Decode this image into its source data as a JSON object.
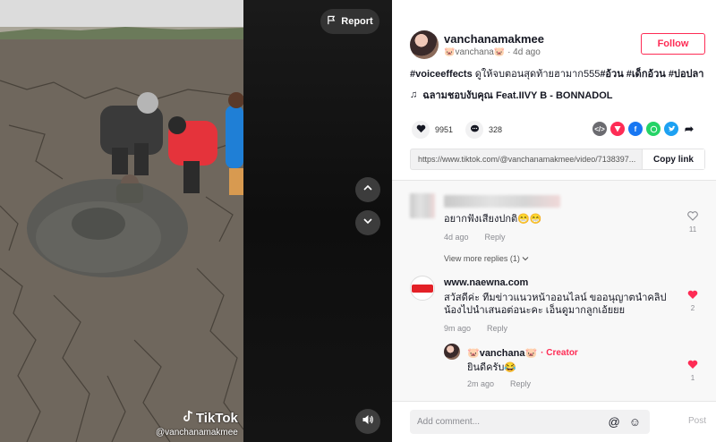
{
  "video": {
    "report_label": "Report",
    "watermark_brand": "TikTok",
    "watermark_user": "@vanchanamakmee"
  },
  "author": {
    "username": "vanchanamakmee",
    "nickname": "🐷vanchana🐷",
    "date": "4d ago",
    "follow_label": "Follow"
  },
  "caption": {
    "tag1": "#voiceeffects",
    "text": "ดูให้จบตอนสุดท้ายฮามาก555",
    "tag2": "#อ้วน",
    "tag3": "#เด็กอ้วน",
    "tag4": "#บ่อปลา"
  },
  "music": "ฉลามชอบงับคุณ Feat.IIVY B - BONNADOL",
  "stats": {
    "likes": "9951",
    "comments": "328"
  },
  "share": {
    "link": "https://www.tiktok.com/@vanchanamakmee/video/7138397...",
    "copy_label": "Copy link"
  },
  "comments": [
    {
      "text": "อยากฟังเสียงปกติ😁😁",
      "time": "4d ago",
      "reply": "Reply",
      "likes": "11"
    },
    {
      "name": "www.naewna.com",
      "text": "สวัสดีค่ะ ทีมข่าวแนวหน้าออนไลน์ ขออนุญาตนำคลิปน้องไปนำเสนอต่อนะคะ เอ็นดูมากลูกเอ้ยยย",
      "time": "9m ago",
      "reply": "Reply",
      "likes": "2"
    }
  ],
  "view_more": "View more replies (1)",
  "reply": {
    "name": "🐷vanchana🐷",
    "badge": "· Creator",
    "text": "ยินดีครับ😂",
    "time": "2m ago",
    "reply": "Reply",
    "likes": "1"
  },
  "comment_bar": {
    "placeholder": "Add comment...",
    "post_label": "Post"
  },
  "colors": {
    "accent": "#fe2c55",
    "text": "#161823",
    "muted": "#8a8b91"
  }
}
